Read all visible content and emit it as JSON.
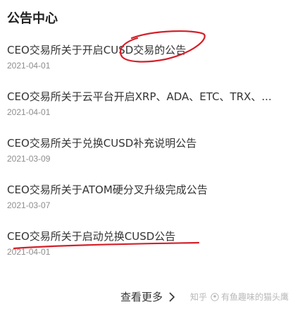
{
  "page": {
    "title": "公告中心"
  },
  "announcements": [
    {
      "title": "CEO交易所关于开启CUSD交易的公告",
      "date": "2021-04-01"
    },
    {
      "title": "CEO交易所关于云平台开启XRP、ADA、ETC、TRX、...",
      "date": "2021-04-01"
    },
    {
      "title": "CEO交易所关于兑换CUSD补充说明公告",
      "date": "2021-03-09"
    },
    {
      "title": "CEO交易所关于ATOM硬分叉升级完成公告",
      "date": "2021-03-07"
    },
    {
      "title": "CEO交易所关于启动兑换CUSD公告",
      "date": "2021-04-01"
    }
  ],
  "footer": {
    "more_label": "查看更多",
    "more_icon": "chevron-right-icon",
    "watermark_site": "知乎",
    "watermark_author": "有鱼趣味的猫头鹰"
  },
  "annotations": {
    "circle_color": "#d4202a",
    "underline_color": "#d4202a"
  }
}
